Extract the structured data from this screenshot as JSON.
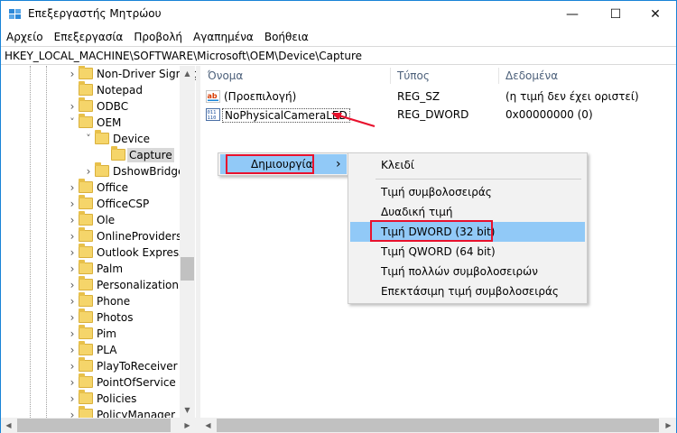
{
  "window": {
    "title": "Επεξεργαστής Μητρώου"
  },
  "controls": {
    "minimize": "—",
    "maximize": "☐",
    "close": "✕"
  },
  "menubar": [
    "Αρχείο",
    "Επεξεργασία",
    "Προβολή",
    "Αγαπημένα",
    "Βοήθεια"
  ],
  "address": "HKEY_LOCAL_MACHINE\\SOFTWARE\\Microsoft\\OEM\\Device\\Capture",
  "tree": [
    {
      "label": "Non-Driver Signing",
      "level": 0,
      "chevron": "collapsed"
    },
    {
      "label": "Notepad",
      "level": 0,
      "chevron": "none"
    },
    {
      "label": "ODBC",
      "level": 0,
      "chevron": "collapsed"
    },
    {
      "label": "OEM",
      "level": 0,
      "chevron": "expanded"
    },
    {
      "label": "Device",
      "level": 1,
      "chevron": "expanded"
    },
    {
      "label": "Capture",
      "level": 2,
      "chevron": "none",
      "selected": true
    },
    {
      "label": "DshowBridge",
      "level": 1,
      "chevron": "collapsed"
    },
    {
      "label": "Office",
      "level": 0,
      "chevron": "collapsed"
    },
    {
      "label": "OfficeCSP",
      "level": 0,
      "chevron": "collapsed"
    },
    {
      "label": "Ole",
      "level": 0,
      "chevron": "collapsed"
    },
    {
      "label": "OnlineProviders",
      "level": 0,
      "chevron": "collapsed"
    },
    {
      "label": "Outlook Express",
      "level": 0,
      "chevron": "collapsed"
    },
    {
      "label": "Palm",
      "level": 0,
      "chevron": "collapsed"
    },
    {
      "label": "Personalization",
      "level": 0,
      "chevron": "collapsed"
    },
    {
      "label": "Phone",
      "level": 0,
      "chevron": "collapsed"
    },
    {
      "label": "Photos",
      "level": 0,
      "chevron": "collapsed"
    },
    {
      "label": "Pim",
      "level": 0,
      "chevron": "collapsed"
    },
    {
      "label": "PLA",
      "level": 0,
      "chevron": "collapsed"
    },
    {
      "label": "PlayToReceiver",
      "level": 0,
      "chevron": "collapsed"
    },
    {
      "label": "PointOfService",
      "level": 0,
      "chevron": "collapsed"
    },
    {
      "label": "Policies",
      "level": 0,
      "chevron": "collapsed"
    },
    {
      "label": "PolicyManager",
      "level": 0,
      "chevron": "collapsed"
    }
  ],
  "columns": {
    "name": "Όνομα",
    "type": "Τύπος",
    "data": "Δεδομένα"
  },
  "values": [
    {
      "name": "(Προεπιλογή)",
      "type": "REG_SZ",
      "data": "(η τιμή δεν έχει οριστεί)",
      "icon": "string-value-icon"
    },
    {
      "name": "NoPhysicalCameraLED",
      "type": "REG_DWORD",
      "data": "0x00000000 (0)",
      "icon": "binary-value-icon"
    }
  ],
  "context_menu": {
    "new_label": "Δημιουργία",
    "submenu_arrow": "›"
  },
  "submenu": [
    "Κλειδί",
    "Τιμή συμβολοσειράς",
    "Δυαδική τιμή",
    "Τιμή DWORD (32 bit)",
    "Τιμή QWORD (64 bit)",
    "Τιμή πολλών συμβολοσειρών",
    "Επεκτάσιμη τιμή συμβολοσειράς"
  ],
  "submenu_highlight": "Τιμή DWORD (32 bit)",
  "colors": {
    "accent": "#1883d7",
    "highlight": "#91c9f7",
    "annotation": "#e8112d"
  }
}
